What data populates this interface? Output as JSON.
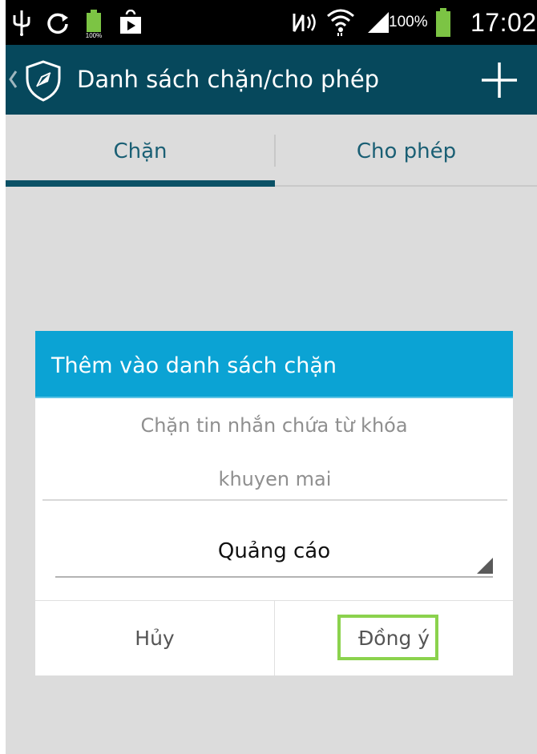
{
  "status_bar": {
    "time": "17:02",
    "battery_percent": "100%",
    "left_icons": [
      "usb-icon",
      "sync-icon",
      "battery-full-notification-icon",
      "play-store-icon"
    ],
    "right_icons": [
      "nfc-icon",
      "wifi-icon",
      "signal-icon",
      "battery-icon"
    ],
    "mini_battery_label": "100%"
  },
  "action_bar": {
    "title": "Danh sách chặn/cho phép",
    "background": "#06485c"
  },
  "tabs": {
    "items": [
      {
        "label": "Chặn",
        "selected": true
      },
      {
        "label": "Cho phép",
        "selected": false
      }
    ]
  },
  "dialog": {
    "title": "Thêm vào danh sách chặn",
    "message": "Chặn tin nhắn chứa từ khóa",
    "keyword_value": "khuyen mai",
    "category_value": "Quảng cáo",
    "cancel_label": "Hủy",
    "ok_label": "Đồng ý",
    "header_color": "#0ba3d4",
    "highlight_color": "#8bd24d"
  }
}
